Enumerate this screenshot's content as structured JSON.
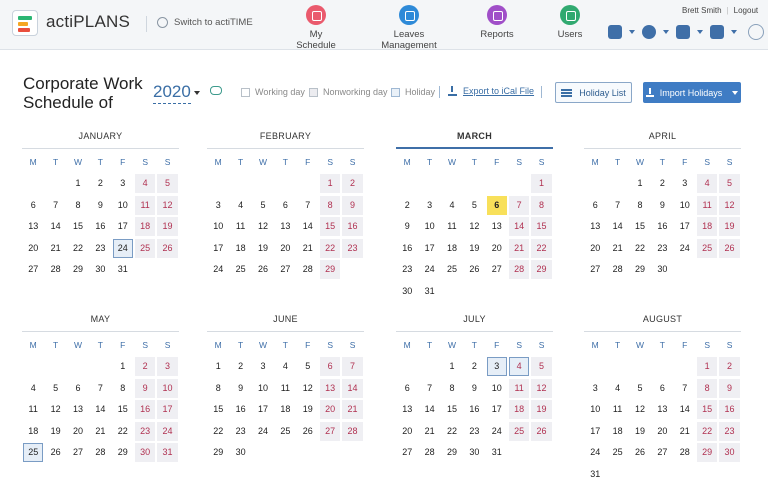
{
  "app": {
    "name": "actiPLANS",
    "switch_label": "Switch to actiTIME"
  },
  "nav": [
    {
      "label": "My Schedule",
      "color": "#ea5a6d"
    },
    {
      "label": "Leaves Management",
      "color": "#2e8ad8"
    },
    {
      "label": "Reports",
      "color": "#a04fc8"
    },
    {
      "label": "Users",
      "color": "#30a970"
    }
  ],
  "user": {
    "name": "Brett Smith",
    "logout": "Logout"
  },
  "toolbar_icons": [
    "calendar-icon",
    "gear-icon",
    "puzzle-icon",
    "help-icon",
    "lightbulb-icon"
  ],
  "header": {
    "title": "Corporate Work Schedule of",
    "year": "2020",
    "legend": {
      "working": "Working day",
      "nonworking": "Nonworking day",
      "holiday": "Holiday"
    },
    "export": "Export to iCal File",
    "holiday_list": "Holiday List",
    "import": "Import Holidays"
  },
  "weekdays": [
    "M",
    "T",
    "W",
    "T",
    "F",
    "S",
    "S"
  ],
  "months": [
    {
      "name": "JANUARY",
      "offset": 2,
      "days": 31
    },
    {
      "name": "FEBRUARY",
      "offset": 5,
      "days": 29
    },
    {
      "name": "MARCH",
      "offset": 6,
      "days": 31
    },
    {
      "name": "APRIL",
      "offset": 2,
      "days": 30
    },
    {
      "name": "MAY",
      "offset": 4,
      "days": 31
    },
    {
      "name": "JUNE",
      "offset": 0,
      "days": 30
    },
    {
      "name": "JULY",
      "offset": 2,
      "days": 31
    },
    {
      "name": "AUGUST",
      "offset": 5,
      "days": 31
    }
  ],
  "current_month": "MARCH",
  "today": {
    "month": "MARCH",
    "day": 6
  },
  "holidays": [
    {
      "month": "JANUARY",
      "day": 24
    },
    {
      "month": "MAY",
      "day": 25
    },
    {
      "month": "JULY",
      "day": 3
    },
    {
      "month": "JULY",
      "day": 4
    }
  ]
}
